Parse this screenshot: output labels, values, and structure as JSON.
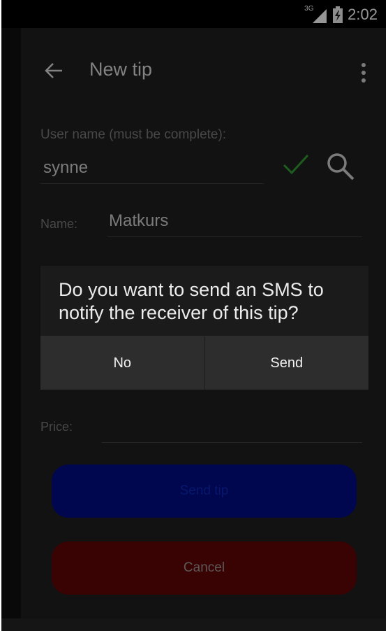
{
  "status_bar": {
    "network": "3G",
    "time": "2:02"
  },
  "app_bar": {
    "title": "New tip",
    "back_icon": "arrow-back-icon",
    "overflow_icon": "more-vert-icon"
  },
  "form": {
    "user_label": "User name (must be complete):",
    "user_value": "synne",
    "user_valid_icon": "check-icon",
    "search_icon": "search-icon",
    "name_label": "Name:",
    "name_value": "Matkurs",
    "price_label": "Price:",
    "price_value": ""
  },
  "buttons": {
    "send_tip": "Send tip",
    "cancel": "Cancel"
  },
  "dialog": {
    "message": "Do you want to send an SMS to notify the receiver of this tip?",
    "no_label": "No",
    "send_label": "Send"
  },
  "colors": {
    "send_tip_bg": "#000c7a",
    "cancel_bg": "#5a0606",
    "check": "#2f8f2f"
  }
}
